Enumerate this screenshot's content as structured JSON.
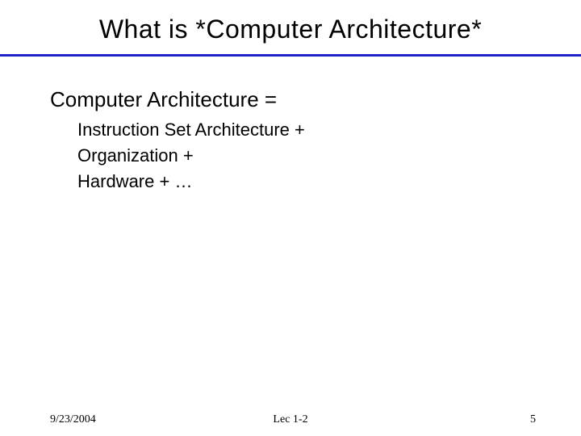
{
  "title": "What is *Computer Architecture*",
  "subheading": "Computer Architecture =",
  "lines": [
    "Instruction Set Architecture  +",
    "Organization +",
    "Hardware + …"
  ],
  "footer": {
    "date": "9/23/2004",
    "center": "Lec 1-2",
    "page": "5"
  }
}
